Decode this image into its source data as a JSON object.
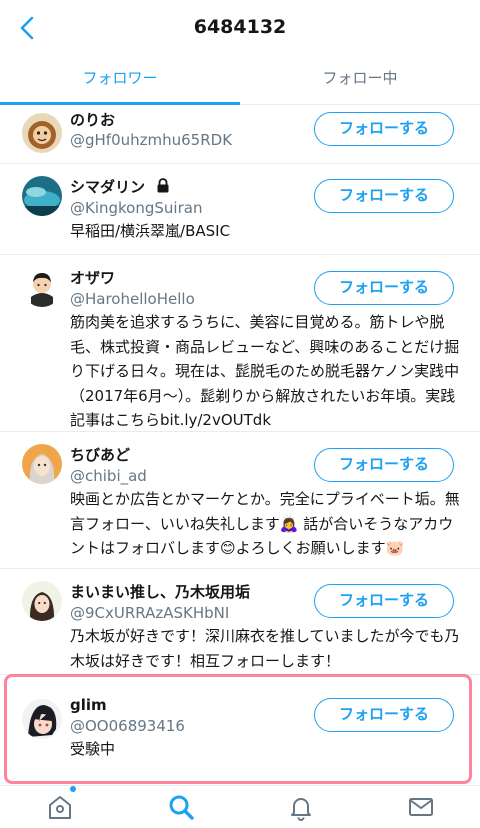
{
  "header": {
    "title": "6484132"
  },
  "tabs": [
    {
      "label": "フォロワー",
      "active": true
    },
    {
      "label": "フォロー中",
      "active": false
    }
  ],
  "follow_label": "フォローする",
  "users": [
    {
      "name": "のりお",
      "handle": "@gHf0uhzmhu65RDK",
      "bio": ""
    },
    {
      "name": "シマダリン",
      "protected": true,
      "handle": "@KingkongSuiran",
      "bio": "早稲田/横浜翠嵐/BASIC"
    },
    {
      "name": "オザワ",
      "handle": "@HarohelloHello",
      "bio": "筋肉美を追求するうちに、美容に目覚める。筋トレや脱毛、株式投資・商品レビューなど、興味のあることだけ掘り下げる日々。現在は、髭脱毛のため脱毛器ケノン実践中（2017年6月〜）。髭剃りから解放されたいお年頃。実践記事はこちらbit.ly/2vOUTdk"
    },
    {
      "name": "ちびあど",
      "handle": "@chibi_ad",
      "bio": "映画とか広告とかマーケとか。完全にプライベート垢。無言フォロー、いいね失礼します🙇‍♀️ 話が合いそうなアカウントはフォロバします😊よろしくお願いします🐷"
    },
    {
      "name": "まいまい推し、乃木坂用垢",
      "handle": "@9CxURRAzASKHbNI",
      "bio": "乃木坂が好きです！深川麻衣を推していましたが今でも乃木坂は好きです！相互フォローします！"
    },
    {
      "name": "glim",
      "handle": "@OO06893416",
      "bio": "受験中"
    }
  ],
  "icons": {
    "back": "chevron-left-icon",
    "lock": "lock-icon",
    "home": "home-icon",
    "search": "search-icon",
    "notifications": "bell-icon",
    "messages": "mail-icon"
  },
  "colors": {
    "accent": "#1da1f2",
    "text": "#14171a",
    "secondary": "#657786",
    "highlight": "#ff6f8a"
  }
}
